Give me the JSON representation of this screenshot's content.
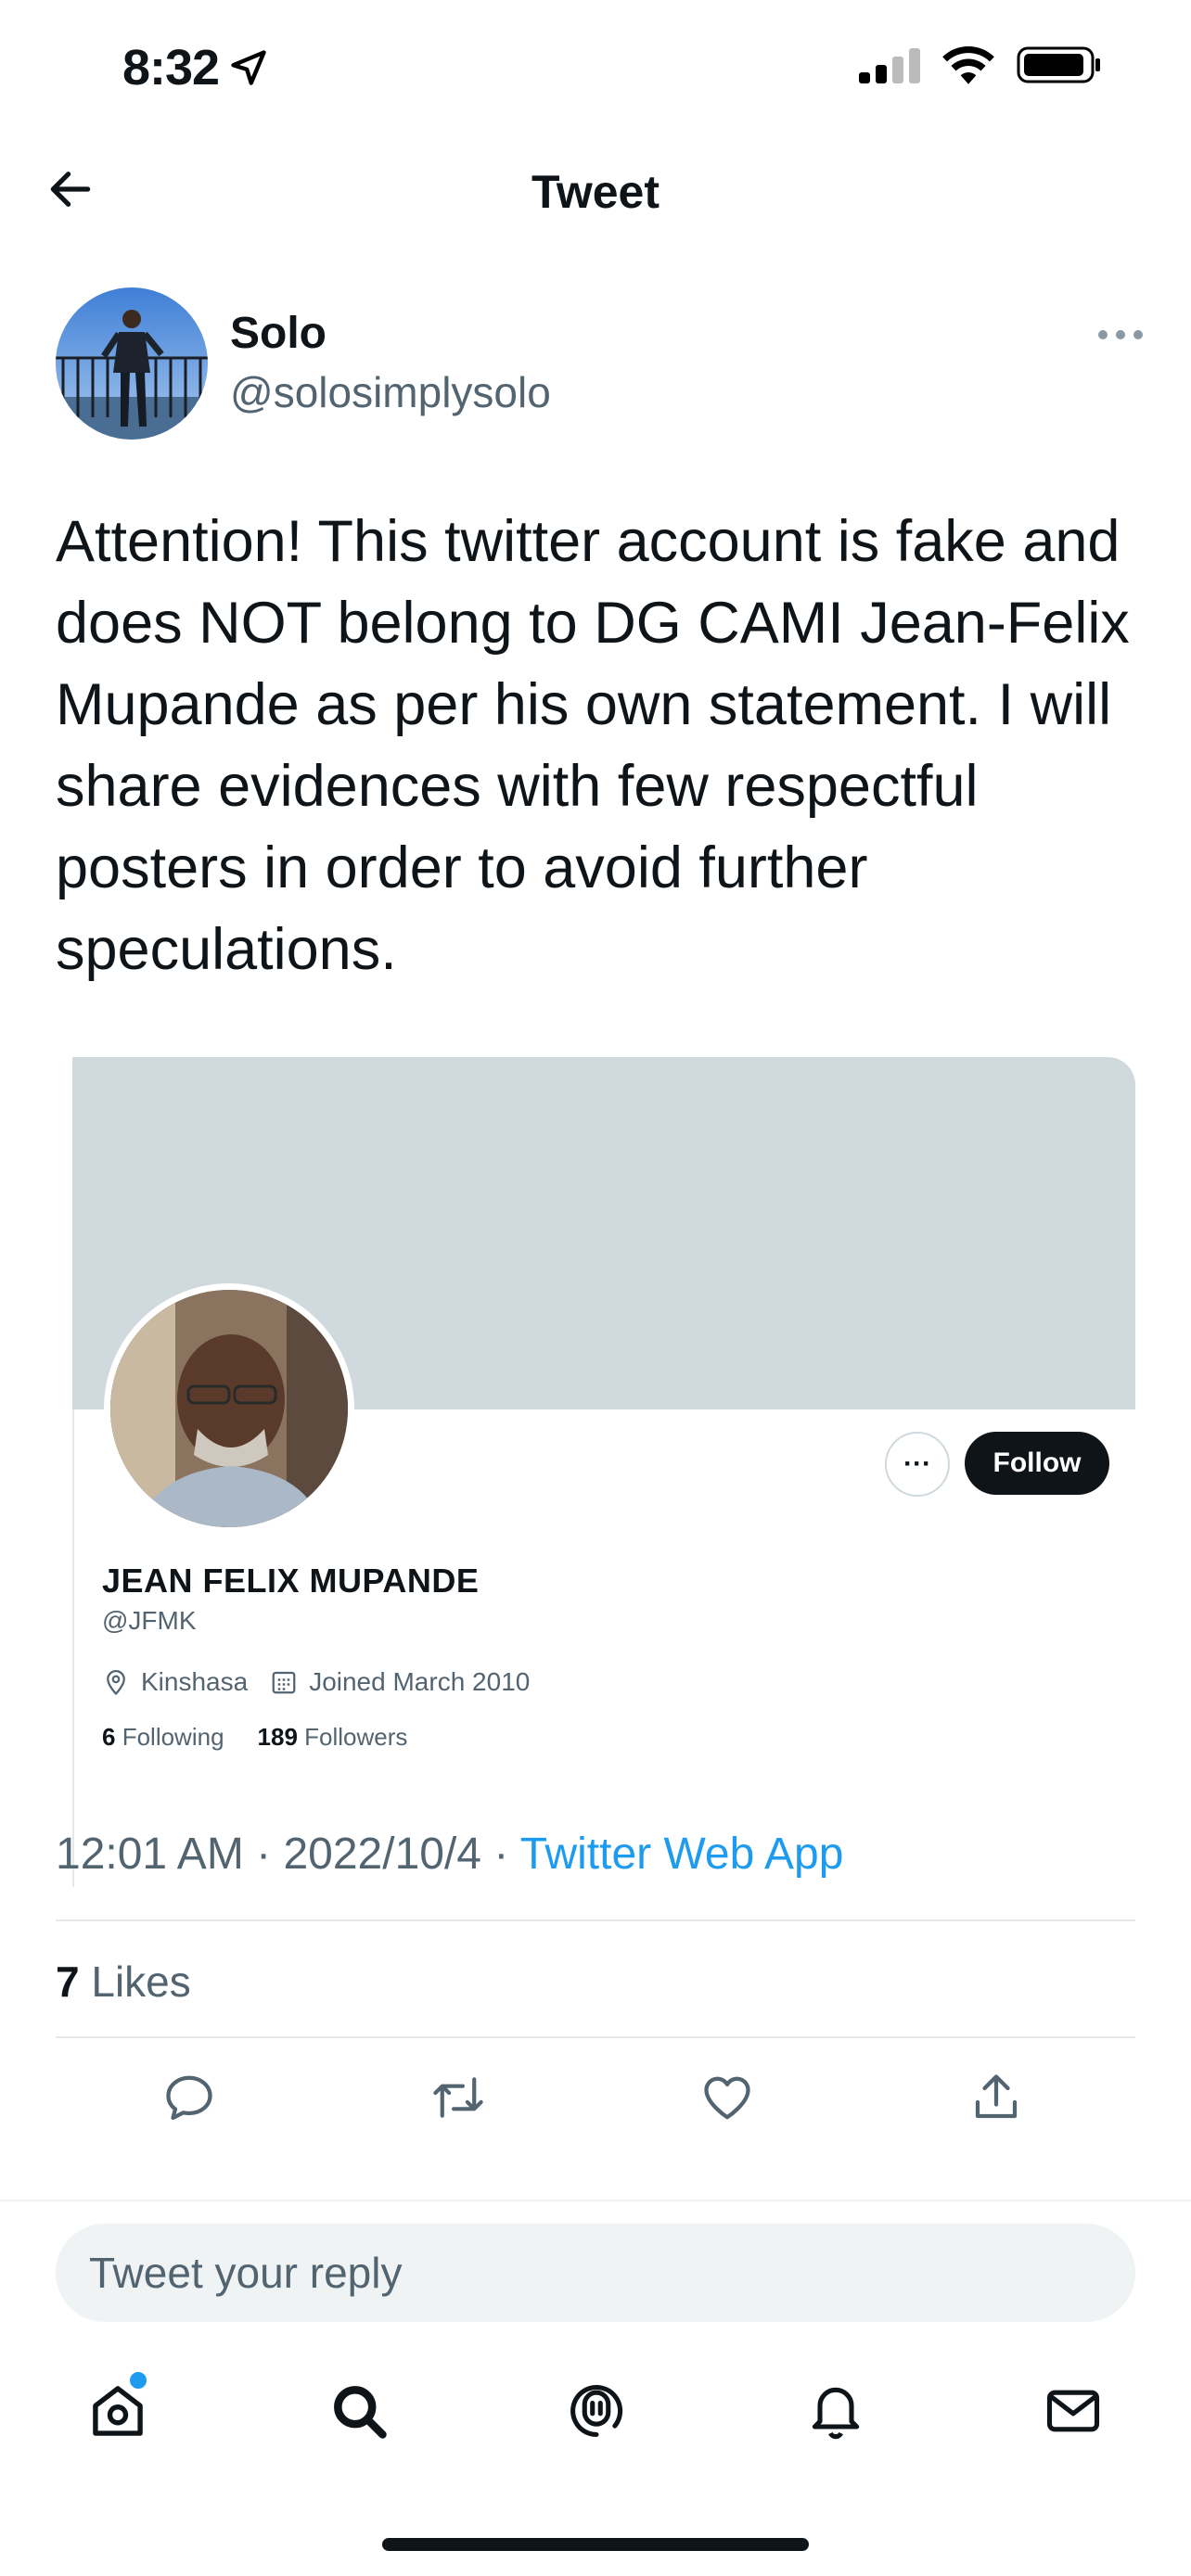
{
  "status_bar": {
    "time": "8:32"
  },
  "header": {
    "title": "Tweet"
  },
  "tweet": {
    "author_name": "Solo",
    "author_handle": "@solosimplysolo",
    "text": "Attention! This twitter account is fake and does NOT belong to DG CAMI Jean-Felix Mupande as per his own statement. I will share evidences with few respectful posters in order to avoid further speculations.",
    "timestamp": "12:01 AM · 2022/10/4 · ",
    "source": "Twitter Web App",
    "likes_count": "7",
    "likes_label": "Likes"
  },
  "embedded_profile": {
    "name": "JEAN FELIX MUPANDE",
    "handle": "@JFMK",
    "location": "Kinshasa",
    "joined": "Joined March 2010",
    "following_count": "6",
    "following_label": "Following",
    "followers_count": "189",
    "followers_label": "Followers",
    "more_label": "···",
    "follow_label": "Follow"
  },
  "reply": {
    "placeholder": "Tweet your reply"
  },
  "colors": {
    "accent": "#1d9bf0",
    "text": "#0f1419",
    "muted": "#536471",
    "banner": "#cfd9de"
  }
}
